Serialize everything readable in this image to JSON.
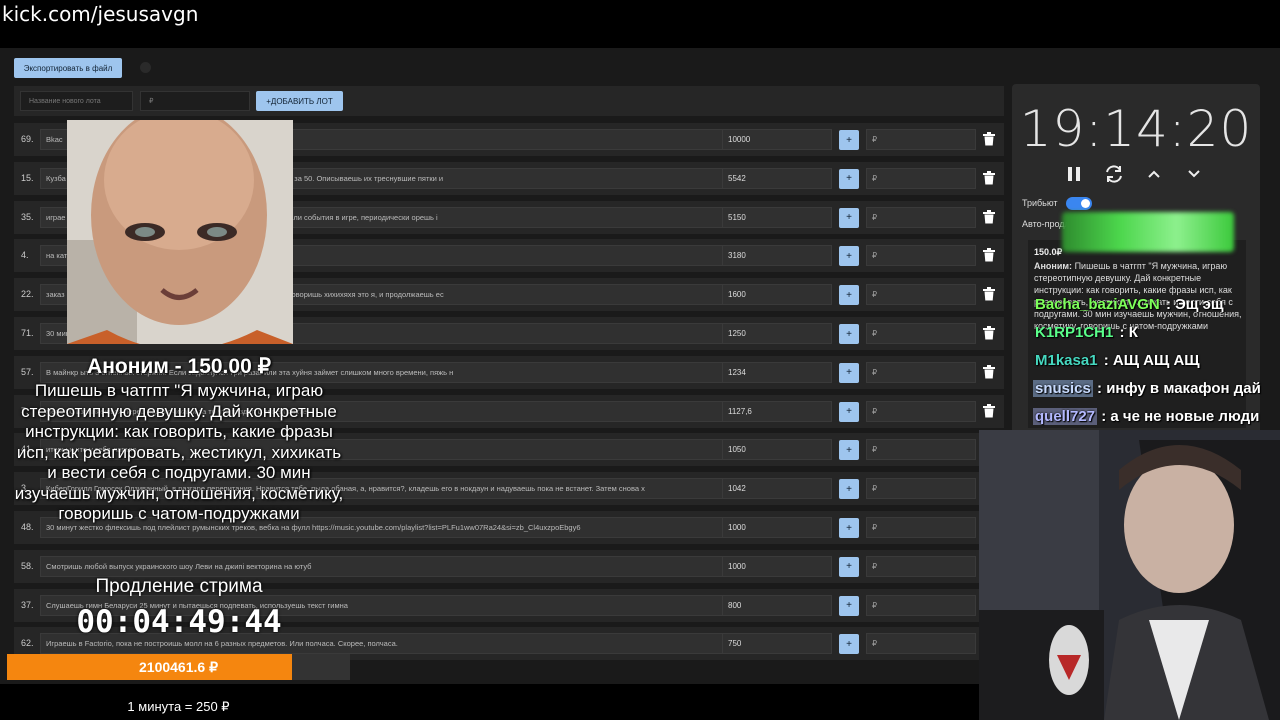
{
  "url": "kick.com/jesusavgn",
  "toolbar": {
    "export_label": "Экспортировать в файл",
    "new_lot_placeholder": "Название нового лота",
    "new_amount_placeholder": "₽",
    "add_lot_label": "+ДОБАВИТЬ ЛОТ"
  },
  "lots": [
    {
      "num": "69.",
      "text": "Bkac",
      "amount": "10000",
      "currency": "₽"
    },
    {
      "num": "15.",
      "text": "Кузба                                   ом лице рассказываешь о том, что тайно мечтаешь о женщинах за 50. Описываешь их треснувшие пятки и",
      "amount": "5542",
      "currency": "₽"
    },
    {
      "num": "35.",
      "text": "играе                                   о с твой компаньон читаешь донаты там тебе донатят задания или события в игре, периодически орешь і",
      "amount": "5150",
      "currency": "₽"
    },
    {
      "num": "4.",
      "text": "на кати                                  оворит",
      "amount": "3180",
      "currency": "₽"
    },
    {
      "num": "22.",
      "text": "заказ                                    едо шапка, и если он говорит словосочетание русская блядота говоришь хихихяхя это я, и продолжаешь ес",
      "amount": "1600",
      "currency": "₽"
    },
    {
      "num": "71.",
      "text": "30 мин                                   Таненбаума 3 глава Управление памятью",
      "amount": "1250",
      "currency": "₽"
    },
    {
      "num": "57.",
      "text": "В майнкр                                 ыть 3 огненных стержня. Если задохнулся три раза. или эта хуйня займет слишком много времени, пяжь н",
      "amount": "1234",
      "currency": "₽"
    },
    {
      "num": "7.",
      "text": "мере                                     00 извиняешься перед подписчиками за то что пиздел о своём росте",
      "amount": "1127,6",
      "currency": "₽"
    },
    {
      "num": "41.",
      "text": "                                         итеры и что у тебя лагало",
      "amount": "1050",
      "currency": "₽"
    },
    {
      "num": "3.",
      "text": "КиберГорилл Гомосек Одзиванный, в разгаре перепитания. Нравится тебе, пыла обаная, а, нравится?, кладешь его в нокдаун и надуваешь пока не встанет. Затем снова х",
      "amount": "1042",
      "currency": "₽"
    },
    {
      "num": "48.",
      "text": "30 минут жестко флексишь под плейлист румынских треков, вебка на фулл https://music.youtube.com/playlist?list=PLFu1ww07Ra24&si=zb_Cl4uxzpoEbgy6",
      "amount": "1000",
      "currency": "₽"
    },
    {
      "num": "58.",
      "text": "Смотришь любой выпуск украинского шоу Леви на джипі векторина на ютуб",
      "amount": "1000",
      "currency": "₽"
    },
    {
      "num": "37.",
      "text": "Слушаешь гимн Беларуси 25 минут и пытаешься подпевать, используешь текст гимна",
      "amount": "800",
      "currency": "₽"
    },
    {
      "num": "62.",
      "text": "Играешь в Factorio, пока не построишь молл на 6 разных предметов. Или полчаса. Скорее, полчаса.",
      "amount": "750",
      "currency": "₽"
    }
  ],
  "timer": {
    "time": "19:14:20",
    "tribute_label": "Трибьют",
    "auto_label": "Авто-продл"
  },
  "donation_card": {
    "amount": "150.0₽",
    "author": "Аноним:",
    "text": "Пишешь в чатгпт \"Я мужчина, играю стереотипную девушку. Дай конкретные инструкции: как говорить, какие фразы исп, как реагировать, жестикул, хихикать и вести себя с подругами. 30 мин изучаешь мужчин, отношения, косметику, говоришь с чатом-подружками"
  },
  "chat": [
    {
      "user": "Bacha_baziAVGN",
      "msg": ": Эщ эщ",
      "color": "#7dff5a",
      "style": "plain"
    },
    {
      "user": "K1RP1CH1",
      "msg": ": К",
      "color": "#5aff8a",
      "style": "plain"
    },
    {
      "user": "M1kasa1",
      "msg": ": АЩ АЩ АЩ",
      "color": "#46d8c0",
      "style": "plain"
    },
    {
      "user": "snusics",
      "msg": ": инфу в макафон дай",
      "color": "#c9dcff",
      "style": "blue"
    },
    {
      "user": "quell727",
      "msg": ": а че не новые люди",
      "color": "#b4b9ff",
      "style": "purple"
    }
  ],
  "overlay": {
    "donor_header": "Аноним - 150.00 ₽",
    "donor_message": "Пишешь в чатгпт \"Я мужчина, играю стереотипную девушку. Дай конкретные инструкции: как говорить, какие фразы исп, как реагировать, жестикул, хихикать и вести себя с подругами.  30 мин изучаешь мужчин, отношения, косметику, говоришь с чатом-подружками",
    "extension_label": "Продление стрима",
    "extension_timer": "00:04:49:44",
    "total": "2100461.6 ₽",
    "total_progress": 0.83,
    "rate": "1 минута = 250 ₽"
  },
  "colors": {
    "accent": "#9ec5ee",
    "progress": "#f5860f",
    "toggle": "#3a86f0"
  }
}
